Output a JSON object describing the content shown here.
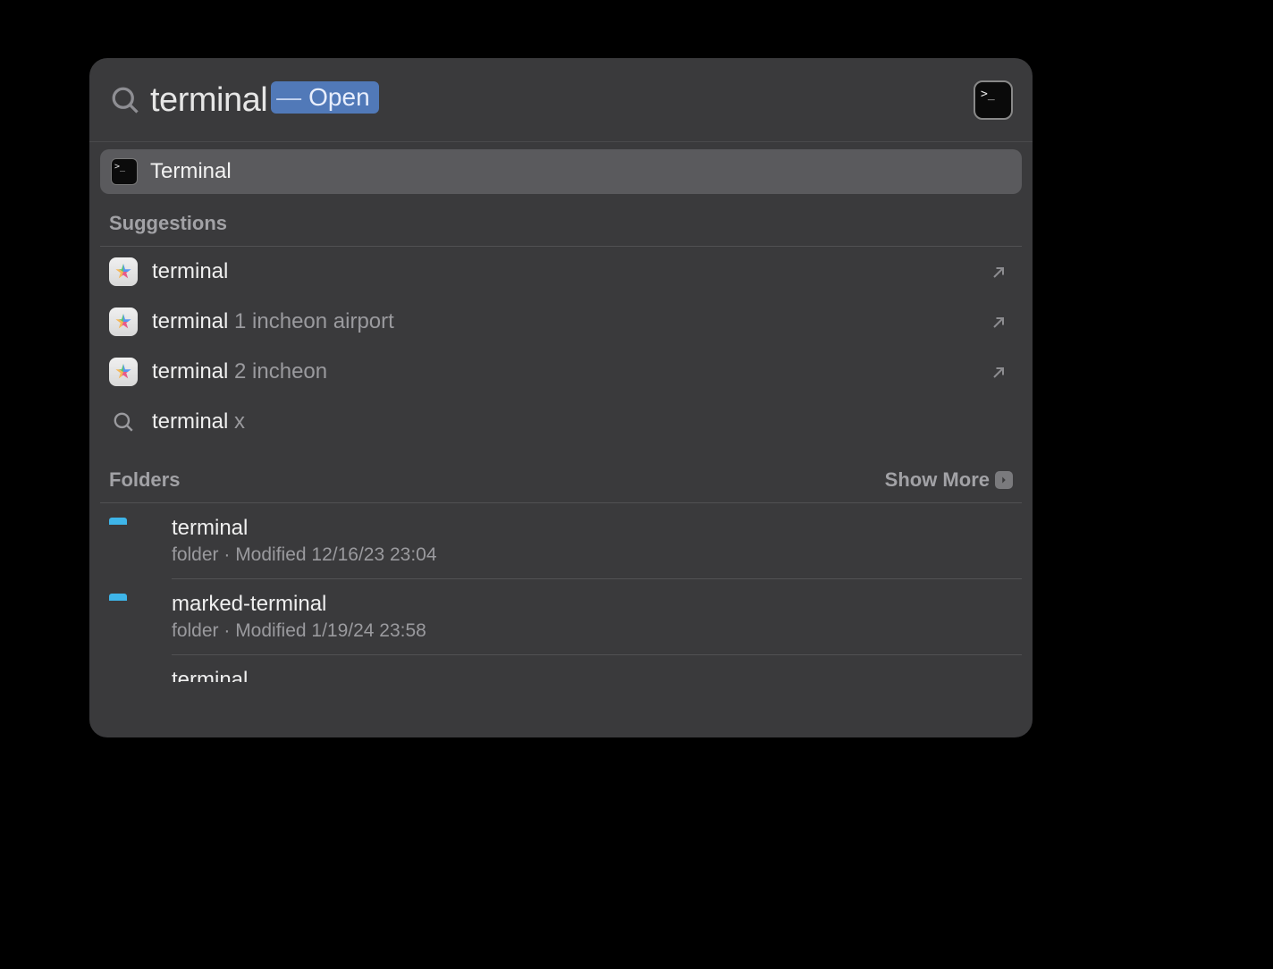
{
  "search": {
    "query": "terminal",
    "actionLabelPrefix": "—",
    "actionLabel": "Open"
  },
  "topHit": {
    "label": "Terminal"
  },
  "suggestionsHeader": "Suggestions",
  "suggestions": [
    {
      "main": "terminal",
      "extra": "",
      "icon": "maps",
      "external": true
    },
    {
      "main": "terminal",
      "extra": " 1 incheon airport",
      "icon": "maps",
      "external": true
    },
    {
      "main": "terminal",
      "extra": " 2 incheon",
      "icon": "maps",
      "external": true
    },
    {
      "main": "terminal",
      "extra": " x",
      "icon": "search",
      "external": false
    }
  ],
  "foldersHeader": "Folders",
  "showMoreLabel": "Show More",
  "folders": [
    {
      "name": "terminal",
      "meta": "folder · Modified 12/16/23 23:04"
    },
    {
      "name": "marked-terminal",
      "meta": "folder · Modified 1/19/24 23:58"
    }
  ],
  "partialFolder": {
    "name": "terminal"
  }
}
